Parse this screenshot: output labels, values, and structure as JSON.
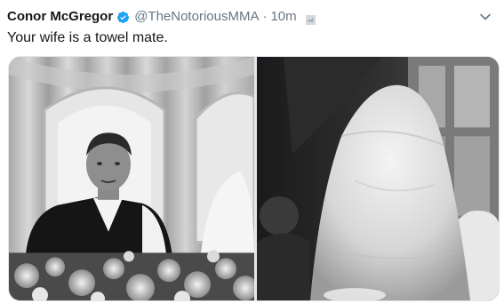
{
  "tweet": {
    "display_name": "Conor McGregor",
    "handle": "@TheNotoriousMMA",
    "separator": "·",
    "timestamp": "10m",
    "text": "Your wife is a towel mate."
  },
  "icons": {
    "verified": "verified-badge-icon",
    "bird": "bird-icon",
    "menu": "chevron-down-icon"
  },
  "colors": {
    "text": "#14171a",
    "secondary": "#657786",
    "verified": "#1da1f2"
  }
}
